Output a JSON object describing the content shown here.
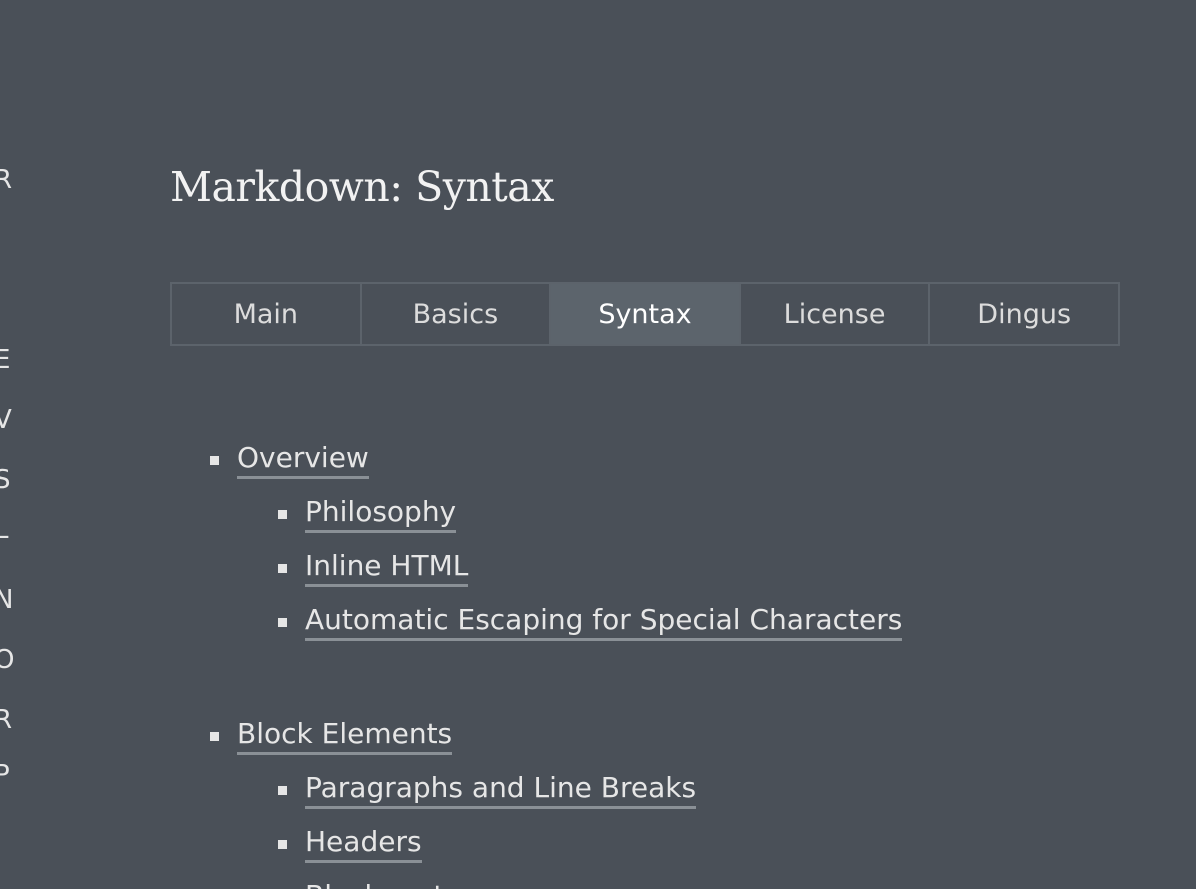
{
  "left_edge_chars": [
    "R",
    "E",
    "V",
    "S",
    "L",
    "N",
    "O",
    "R",
    "P"
  ],
  "page_title": "Markdown: Syntax",
  "tabs": [
    {
      "label": "Main",
      "active": false
    },
    {
      "label": "Basics",
      "active": false
    },
    {
      "label": "Syntax",
      "active": true
    },
    {
      "label": "License",
      "active": false
    },
    {
      "label": "Dingus",
      "active": false
    }
  ],
  "toc": {
    "overview": "Overview",
    "philosophy": "Philosophy",
    "inline_html": "Inline HTML",
    "automatic_escaping": "Automatic Escaping for Special Characters",
    "block_elements": "Block Elements",
    "paragraphs": "Paragraphs and Line Breaks",
    "headers": "Headers",
    "blockquotes": "Blockquotes"
  },
  "colors": {
    "background": "#4a5058",
    "active_tab": "#5c646c",
    "border": "#5c636b",
    "link_underline": "#8a9096"
  }
}
